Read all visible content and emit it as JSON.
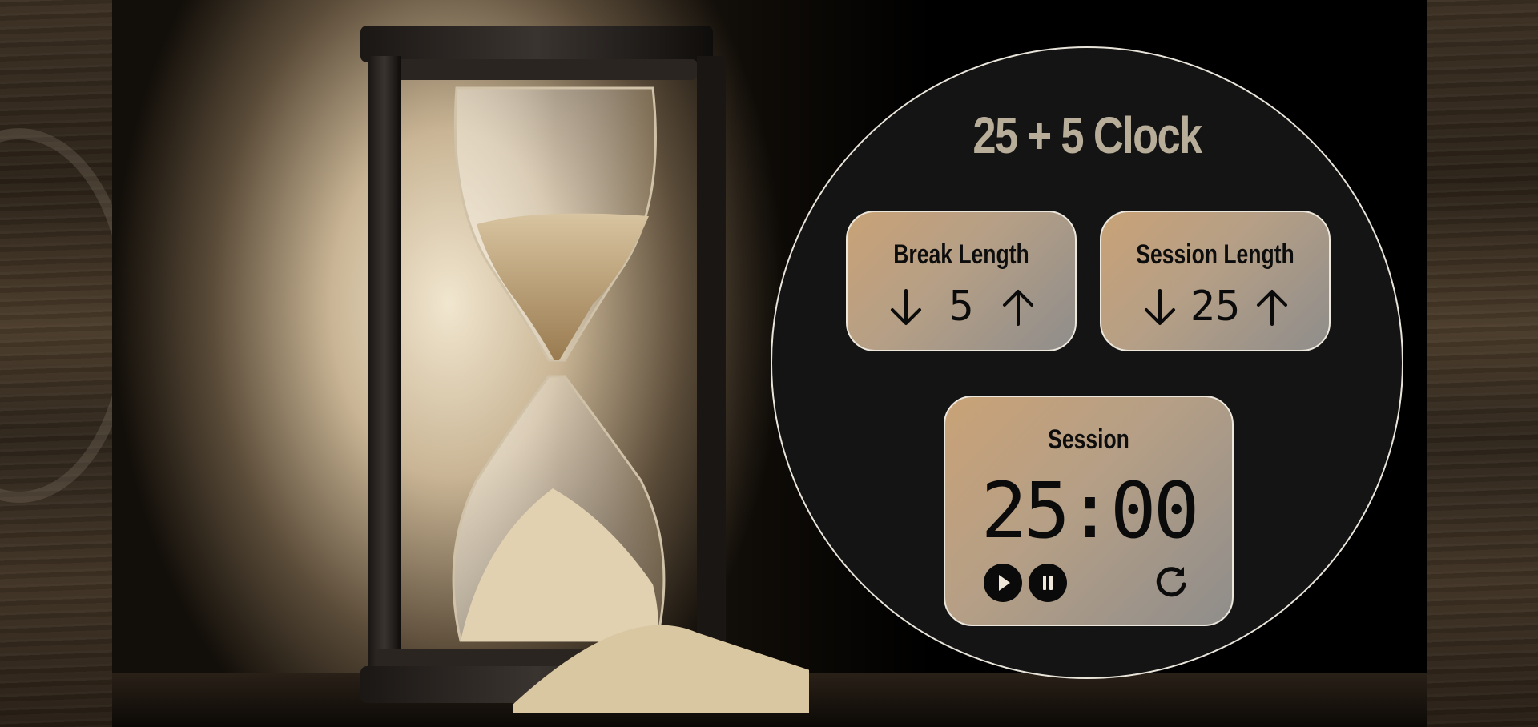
{
  "app": {
    "title": "25 + 5 Clock"
  },
  "break_control": {
    "label": "Break Length",
    "value": "5",
    "decrement_icon": "arrow-down-icon",
    "increment_icon": "arrow-up-icon"
  },
  "session_control": {
    "label": "Session Length",
    "value": "25",
    "decrement_icon": "arrow-down-icon",
    "increment_icon": "arrow-up-icon"
  },
  "timer": {
    "label": "Session",
    "display": "25:00",
    "play_icon": "play-icon",
    "pause_icon": "pause-icon",
    "reset_icon": "reset-icon"
  },
  "colors": {
    "card_gradient_start": "#c9a277",
    "card_gradient_end": "#8f8d8b",
    "title": "#b7ad98",
    "clock_face": "#141414",
    "clock_border": "#e9e4da"
  }
}
